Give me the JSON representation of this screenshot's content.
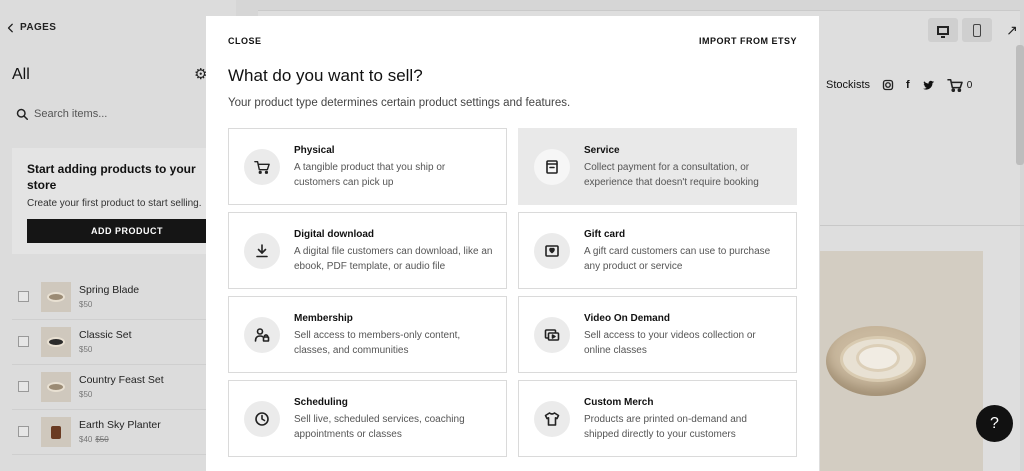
{
  "sidebar": {
    "back_label": "PAGES",
    "title": "All",
    "search_placeholder": "Search items...",
    "promo": {
      "title": "Start adding products to your store",
      "text": "Create your first product to start selling.",
      "button": "ADD PRODUCT"
    },
    "products": [
      {
        "name": "Spring Blade",
        "price": "$50",
        "old_price": ""
      },
      {
        "name": "Classic Set",
        "price": "$50",
        "old_price": ""
      },
      {
        "name": "Country Feast Set",
        "price": "$50",
        "old_price": ""
      },
      {
        "name": "Earth Sky Planter",
        "price": "$40",
        "old_price": "$50"
      }
    ]
  },
  "preview": {
    "nav_link": "Stockists",
    "cart_count": "0",
    "help_label": "?"
  },
  "modal": {
    "close_label": "CLOSE",
    "import_label": "IMPORT FROM ETSY",
    "title": "What do you want to sell?",
    "subtitle": "Your product type determines certain product settings and features.",
    "options": [
      {
        "title": "Physical",
        "desc": "A tangible product that you ship or customers can pick up",
        "icon": "cart-icon"
      },
      {
        "title": "Service",
        "desc": "Collect payment for a consultation, or experience that doesn't require booking",
        "icon": "clipboard-icon",
        "selected": true
      },
      {
        "title": "Digital download",
        "desc": "A digital file customers can download, like an ebook, PDF template, or audio file",
        "icon": "download-icon"
      },
      {
        "title": "Gift card",
        "desc": "A gift card customers can use to purchase any product or service",
        "icon": "gift-card-icon"
      },
      {
        "title": "Membership",
        "desc": "Sell access to members-only content, classes, and communities",
        "icon": "member-lock-icon"
      },
      {
        "title": "Video On Demand",
        "desc": "Sell access to your videos collection or online classes",
        "icon": "video-icon"
      },
      {
        "title": "Scheduling",
        "desc": "Sell live, scheduled services, coaching appointments or classes",
        "icon": "clock-icon"
      },
      {
        "title": "Custom Merch",
        "desc": "Products are printed on-demand and shipped directly to your customers",
        "icon": "tshirt-icon"
      }
    ]
  }
}
